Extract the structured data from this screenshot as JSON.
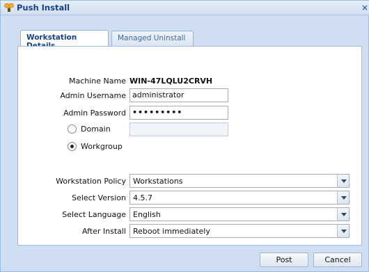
{
  "window": {
    "title": "Push Install",
    "close_glyph": "×"
  },
  "tabs": [
    {
      "label": "Workstation Details",
      "active": true
    },
    {
      "label": "Managed Uninstall",
      "active": false
    }
  ],
  "form": {
    "machine_name_label": "Machine Name",
    "machine_name_value": "WIN-47LQLU2CRVH",
    "admin_username_label": "Admin Username",
    "admin_username_value": "administrator",
    "admin_password_label": "Admin Password",
    "admin_password_mask": "•••••••••",
    "domain_label": "Domain",
    "domain_value": "",
    "workgroup_label": "Workgroup",
    "selected_mode": "Workgroup",
    "workstation_policy_label": "Workstation Policy",
    "workstation_policy_value": "Workstations",
    "select_version_label": "Select Version",
    "select_version_value": "4.5.7",
    "select_language_label": "Select Language",
    "select_language_value": "English",
    "after_install_label": "After Install",
    "after_install_value": "Reboot immediately"
  },
  "buttons": {
    "post": "Post",
    "cancel": "Cancel"
  },
  "icons": {
    "title": "push-install-icon",
    "close": "close-icon",
    "dropdown": "chevron-down-icon"
  },
  "colors": {
    "title_text": "#15428b",
    "window_bg": "#cfdef0",
    "border": "#99bbe8"
  }
}
